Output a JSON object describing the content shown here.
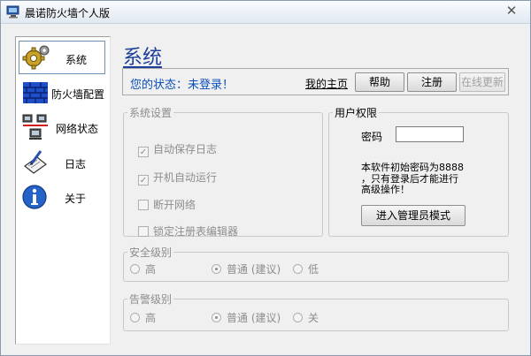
{
  "window": {
    "title": "晨诺防火墙个人版",
    "close_glyph": "✕"
  },
  "sidebar": {
    "items": [
      {
        "label": "系统",
        "icon": "gear-icon"
      },
      {
        "label": "防火墙配置",
        "icon": "brick-wall-icon"
      },
      {
        "label": "网络状态",
        "icon": "network-computers-icon"
      },
      {
        "label": "日志",
        "icon": "log-pen-icon"
      },
      {
        "label": "关于",
        "icon": "info-icon"
      }
    ]
  },
  "main": {
    "title": "系统",
    "status": {
      "text": "您的状态：未登录！",
      "home_link": "我的主页",
      "help_button": "帮助",
      "register_button": "注册",
      "update_button": "在线更新"
    },
    "system_settings": {
      "legend": "系统设置",
      "options": [
        {
          "label": "自动保存日志",
          "checked": true
        },
        {
          "label": "开机自动运行",
          "checked": true
        },
        {
          "label": "断开网络",
          "checked": false
        },
        {
          "label": "锁定注册表编辑器",
          "checked": false
        }
      ]
    },
    "user_rights": {
      "legend": "用户权限",
      "password_label": "密码",
      "password_value": "",
      "info_lines": [
        "本软件初始密码为8888",
        "，只有登录后才能进行",
        "高级操作！"
      ],
      "admin_button": "进入管理员模式"
    },
    "security_level": {
      "legend": "安全级别",
      "options": [
        "高",
        "普通 (建议)",
        "低"
      ],
      "selected": "普通 (建议)"
    },
    "alert_level": {
      "legend": "告警级别",
      "options": [
        "高",
        "普通 (建议)",
        "关"
      ],
      "selected": "普通 (建议)"
    }
  },
  "colors": {
    "heading": "#1c3f99",
    "status_text": "#0a4fb8",
    "disabled_text": "#8d8d8d"
  }
}
